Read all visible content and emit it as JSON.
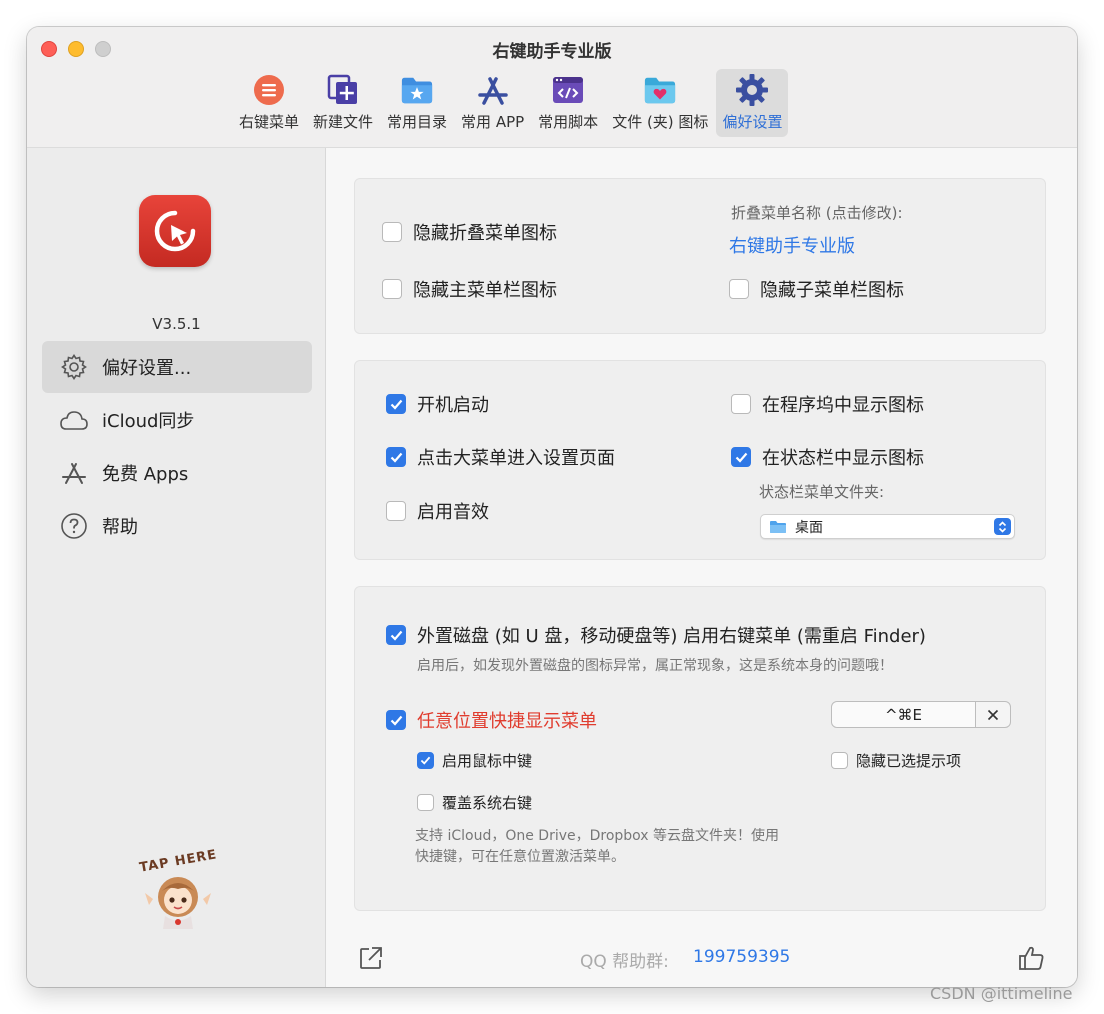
{
  "window": {
    "title": "右键助手专业版"
  },
  "toolbar": {
    "items": [
      {
        "label": "右键菜单",
        "icon": "list-circle-icon"
      },
      {
        "label": "新建文件",
        "icon": "new-file-icon"
      },
      {
        "label": "常用目录",
        "icon": "folder-star-icon"
      },
      {
        "label": "常用 APP",
        "icon": "app-store-icon"
      },
      {
        "label": "常用脚本",
        "icon": "script-icon"
      },
      {
        "label": "文件 (夹) 图标",
        "icon": "folder-heart-icon"
      },
      {
        "label": "偏好设置",
        "icon": "gear-icon"
      }
    ],
    "active": "偏好设置"
  },
  "sidebar": {
    "version": "V3.5.1",
    "items": [
      {
        "label": "偏好设置...",
        "icon": "gear-icon"
      },
      {
        "label": "iCloud同步",
        "icon": "cloud-icon"
      },
      {
        "label": "免费 Apps",
        "icon": "app-store-icon"
      },
      {
        "label": "帮助",
        "icon": "help-icon"
      }
    ],
    "mascot_text": "TAP HERE"
  },
  "panel1": {
    "hide_collapse_icon": {
      "label": "隐藏折叠菜单图标",
      "checked": false
    },
    "hide_main_icon": {
      "label": "隐藏主菜单栏图标",
      "checked": false
    },
    "hide_sub_icon": {
      "label": "隐藏子菜单栏图标",
      "checked": false
    },
    "collapse_name_label": "折叠菜单名称 (点击修改):",
    "collapse_name_value": "右键助手专业版"
  },
  "panel2": {
    "launch_at_login": {
      "label": "开机启动",
      "checked": true
    },
    "click_menu_settings": {
      "label": "点击大菜单进入设置页面",
      "checked": true
    },
    "enable_sound": {
      "label": "启用音效",
      "checked": false
    },
    "show_in_dock": {
      "label": "在程序坞中显示图标",
      "checked": false
    },
    "show_in_statusbar": {
      "label": "在状态栏中显示图标",
      "checked": true
    },
    "statusbar_folder_label": "状态栏菜单文件夹:",
    "statusbar_folder_value": "桌面"
  },
  "panel3": {
    "external_disk": {
      "label": "外置磁盘 (如 U 盘，移动硬盘等) 启用右键菜单 (需重启 Finder)",
      "checked": true
    },
    "external_disk_note": "启用后，如发现外置磁盘的图标异常，属正常现象，这是系统本身的问题哦！",
    "quick_menu": {
      "label": "任意位置快捷显示菜单",
      "checked": true
    },
    "shortcut": "^⌘E",
    "middle_click": {
      "label": "启用鼠标中键",
      "checked": true
    },
    "hide_selected_hint": {
      "label": "隐藏已选提示项",
      "checked": false
    },
    "override_right_click": {
      "label": "覆盖系统右键",
      "checked": false
    },
    "cloud_note_1": "支持 iCloud，One Drive，Dropbox 等云盘文件夹！使用",
    "cloud_note_2": "快捷键，可在任意位置激活菜单。"
  },
  "footer": {
    "qq_label": "QQ 帮助群:",
    "qq_number": "199759395"
  },
  "watermark": "CSDN @ittimeline",
  "colors": {
    "accent": "#2f78e6",
    "red": "#e03c2e",
    "app_icon": "#d9362d"
  }
}
